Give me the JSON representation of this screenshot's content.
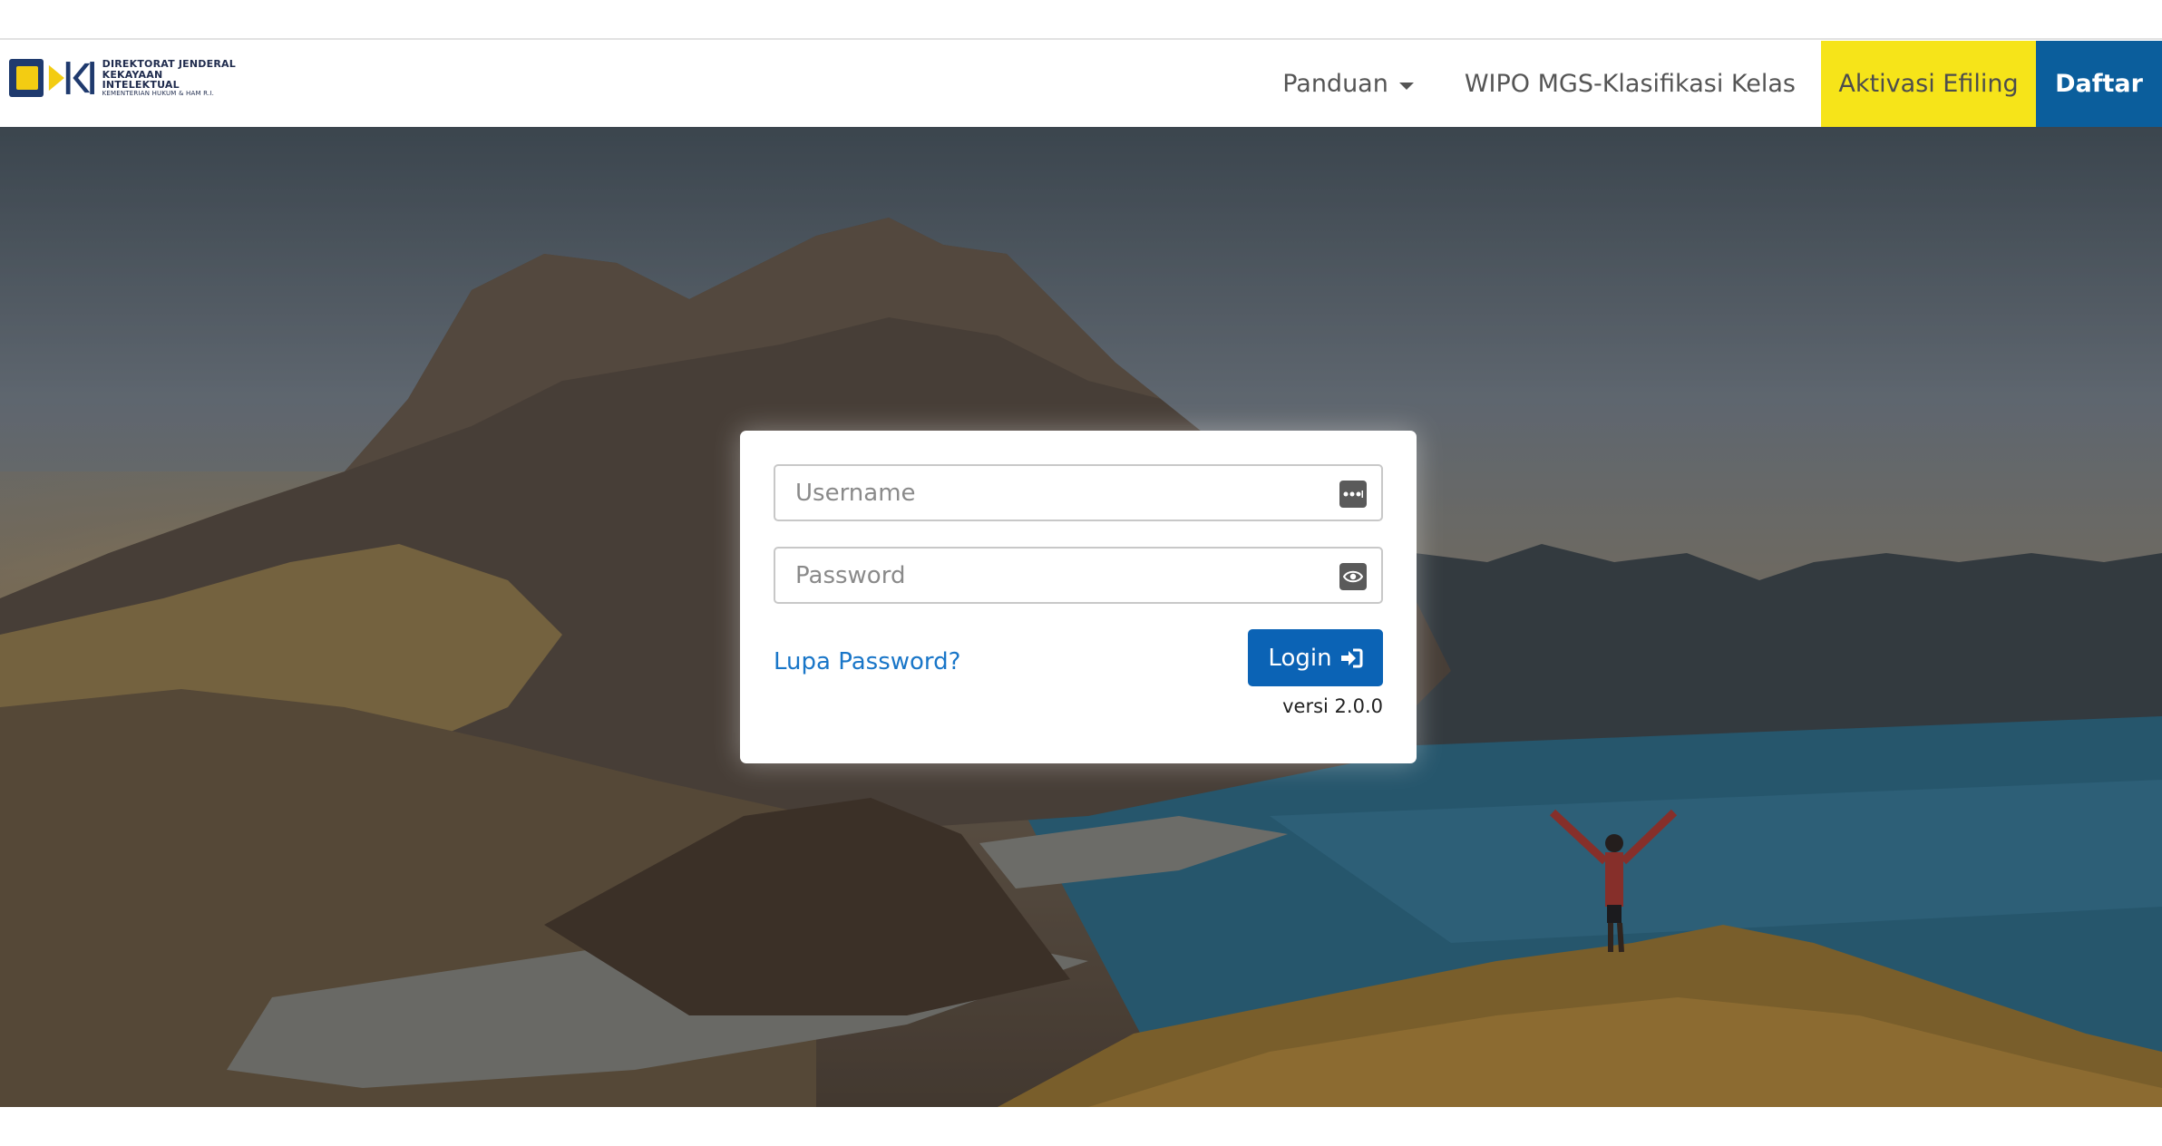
{
  "header": {
    "logo": {
      "line1": "DIREKTORAT JENDERAL",
      "line2": "KEKAYAAN INTELEKTUAL",
      "line3": "KEMENTERIAN HUKUM & HAM R.I."
    },
    "nav": {
      "panduan_label": "Panduan",
      "wipo_label": "WIPO MGS-Klasifikasi Kelas",
      "aktivasi_label": "Aktivasi Efiling",
      "daftar_label": "Daftar"
    }
  },
  "login": {
    "username_placeholder": "Username",
    "username_value": "",
    "password_placeholder": "Password",
    "password_value": "",
    "forgot_label": "Lupa Password?",
    "login_label": "Login",
    "version": "versi 2.0.0"
  },
  "colors": {
    "aktivasi_bg": "#f6e419",
    "daftar_bg": "#0b5e9c",
    "login_button": "#0b63b5",
    "link": "#1976c8"
  },
  "icons": {
    "username_field": "dots-icon",
    "password_field": "eye-icon",
    "login_button": "sign-in-icon",
    "panduan": "caret-down-icon"
  }
}
